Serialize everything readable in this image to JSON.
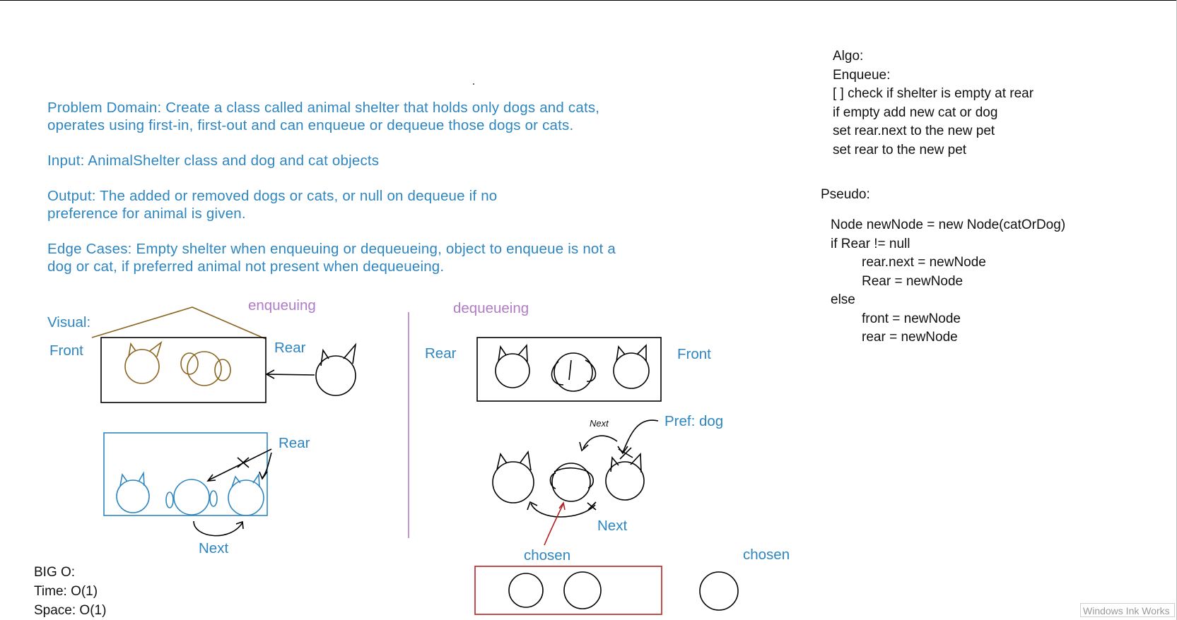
{
  "problem": {
    "domain": "Problem Domain: Create a class called animal shelter that holds only dogs and cats, operates using first-in, first-out and can enqueue or dequeue those dogs or cats.",
    "input": "Input: AnimalShelter class and dog and cat objects",
    "output": "Output: The added or removed dogs or cats, or null on dequeue if no preference for animal is given.",
    "edge_cases": "Edge Cases: Empty shelter when enqueuing or dequeueing, object to enqueue is not a dog or cat, if preferred animal not present when dequeueing.",
    "visual": "Visual:"
  },
  "enqueue_diagram": {
    "title": "enqueuing",
    "front": "Front",
    "rear_top": "Rear",
    "rear_bottom": "Rear",
    "next": "Next"
  },
  "dequeue_diagram": {
    "title": "dequeueing",
    "rear": "Rear",
    "front": "Front",
    "next_small": "Next",
    "pref": "Pref: dog",
    "next": "Next",
    "chosen_left": "chosen",
    "chosen_right": "chosen"
  },
  "algo": {
    "title": "Algo:",
    "enqueue": "Enqueue:",
    "step1": "[ ] check if shelter is empty at rear",
    "step2": "if empty add new cat or dog",
    "step3": "set rear.next to the new pet",
    "step4": "set rear to the new pet"
  },
  "pseudo": {
    "title": "Pseudo:",
    "lines": [
      "Node newNode = new Node(catOrDog)",
      "if Rear != null",
      "rear.next = newNode",
      "Rear = newNode",
      "else",
      "front = newNode",
      "rear = newNode"
    ]
  },
  "big_o": {
    "title": "BIG O:",
    "time": "Time: O(1)",
    "space": "Space: O(1)"
  },
  "badge": "Windows Ink Works",
  "colors": {
    "text_blue": "#2e86c1",
    "ink_brown": "#8a6420",
    "ink_blue": "#2e86c1",
    "ink_purple": "#b07cc6",
    "ink_red": "#b22222"
  }
}
